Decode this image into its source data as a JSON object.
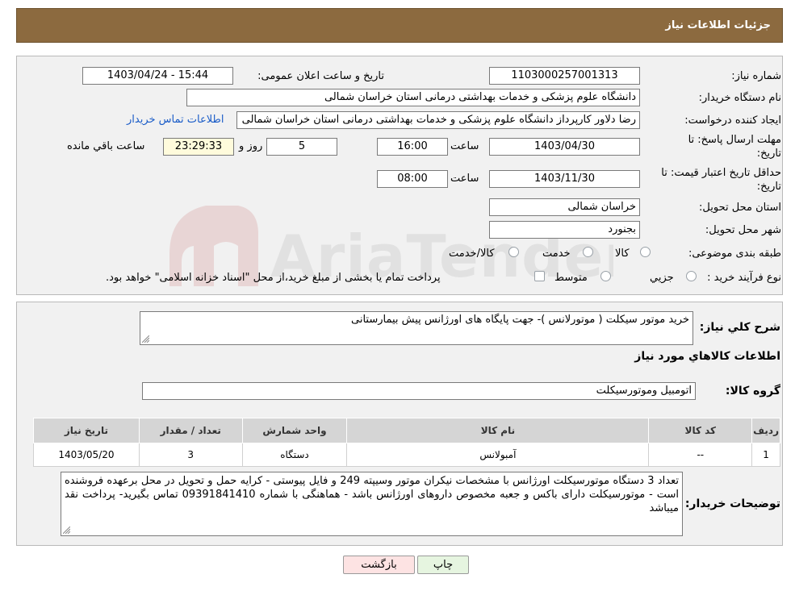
{
  "header": {
    "title": "جزئیات اطلاعات نیاز"
  },
  "fields": {
    "need_number": {
      "label": "شماره نیاز:",
      "value": "1103000257001313"
    },
    "announce_datetime": {
      "label": "تاریخ و ساعت اعلان عمومی:",
      "value": "1403/04/24 - 15:44"
    },
    "buyer_org": {
      "label": "نام دستگاه خریدار:",
      "value": "دانشگاه علوم پزشکی و خدمات بهداشتی درمانی استان خراسان شمالی"
    },
    "requester": {
      "label": "ایجاد کننده درخواست:",
      "value": "رضا دلاور کارپرداز  دانشگاه علوم پزشکی و خدمات بهداشتی درمانی استان خراسان شمالی",
      "contact_link": "اطلاعات تماس خریدار"
    },
    "reply_deadline": {
      "label_line1": "مهلت ارسال پاسخ: تا",
      "label_line2": "تاریخ:",
      "date": "1403/04/30",
      "time_label": "ساعت",
      "time": "16:00",
      "days": "5",
      "days_label": "روز و",
      "remaining": "23:29:33",
      "remaining_label": "ساعت باقي مانده"
    },
    "price_validity": {
      "label_line1": "حداقل تاریخ اعتبار قیمت: تا",
      "label_line2": "تاریخ:",
      "date": "1403/11/30",
      "time_label": "ساعت",
      "time": "08:00"
    },
    "delivery_province": {
      "label": "استان محل تحویل:",
      "value": "خراسان شمالی"
    },
    "delivery_city": {
      "label": "شهر محل تحویل:",
      "value": "بجنورد"
    },
    "category": {
      "label": "طبقه بندی موضوعی:",
      "options": [
        "کالا",
        "خدمت",
        "کالا/خدمت"
      ]
    },
    "process_type": {
      "label": "نوع فرآیند خرید :",
      "options": [
        "جزيي",
        "متوسط"
      ],
      "note": "پرداخت تمام یا بخشی از مبلغ خرید،از محل \"اسناد خزانه اسلامی\" خواهد بود."
    }
  },
  "summary": {
    "label": "شرح کلي نياز:",
    "value": "خرید موتور سیکلت ( موتورلانس )- جهت پایگاه های اورژانس پیش بیمارستانی"
  },
  "goods_section_title": "اطلاعات کالاهاي مورد نياز",
  "goods_group": {
    "label": "گروه کالا:",
    "value": "اتومبیل وموتورسیکلت"
  },
  "table": {
    "headers": [
      "رديف",
      "کد کالا",
      "نام کالا",
      "واحد شمارش",
      "تعداد / مقدار",
      "تاريخ نياز"
    ],
    "rows": [
      [
        "1",
        "--",
        "آمبولانس",
        "دستگاه",
        "3",
        "1403/05/20"
      ]
    ]
  },
  "buyer_notes": {
    "label": "توضیحات خریدار:",
    "value": "تعداد 3 دستگاه موتورسیکلت اورژانس با مشخصات نیکران موتور وسیپته 249 و فایل پیوستی - کرایه حمل و تحویل در محل برعهده فروشنده است - موتورسیکلت دارای باکس و جعبه مخصوص داروهای اورژانس باشد - هماهنگی با شماره 09391841410 تماس بگیرید- پرداخت نقد میباشد"
  },
  "buttons": {
    "print": "چاپ",
    "back": "بازگشت"
  },
  "watermark": {
    "text": "AriaTender.neT"
  },
  "colors": {
    "header": "#8c6a3f",
    "back_button": "#fde3e3",
    "print_button": "#e6f5e0",
    "link": "#1a5cc8"
  }
}
